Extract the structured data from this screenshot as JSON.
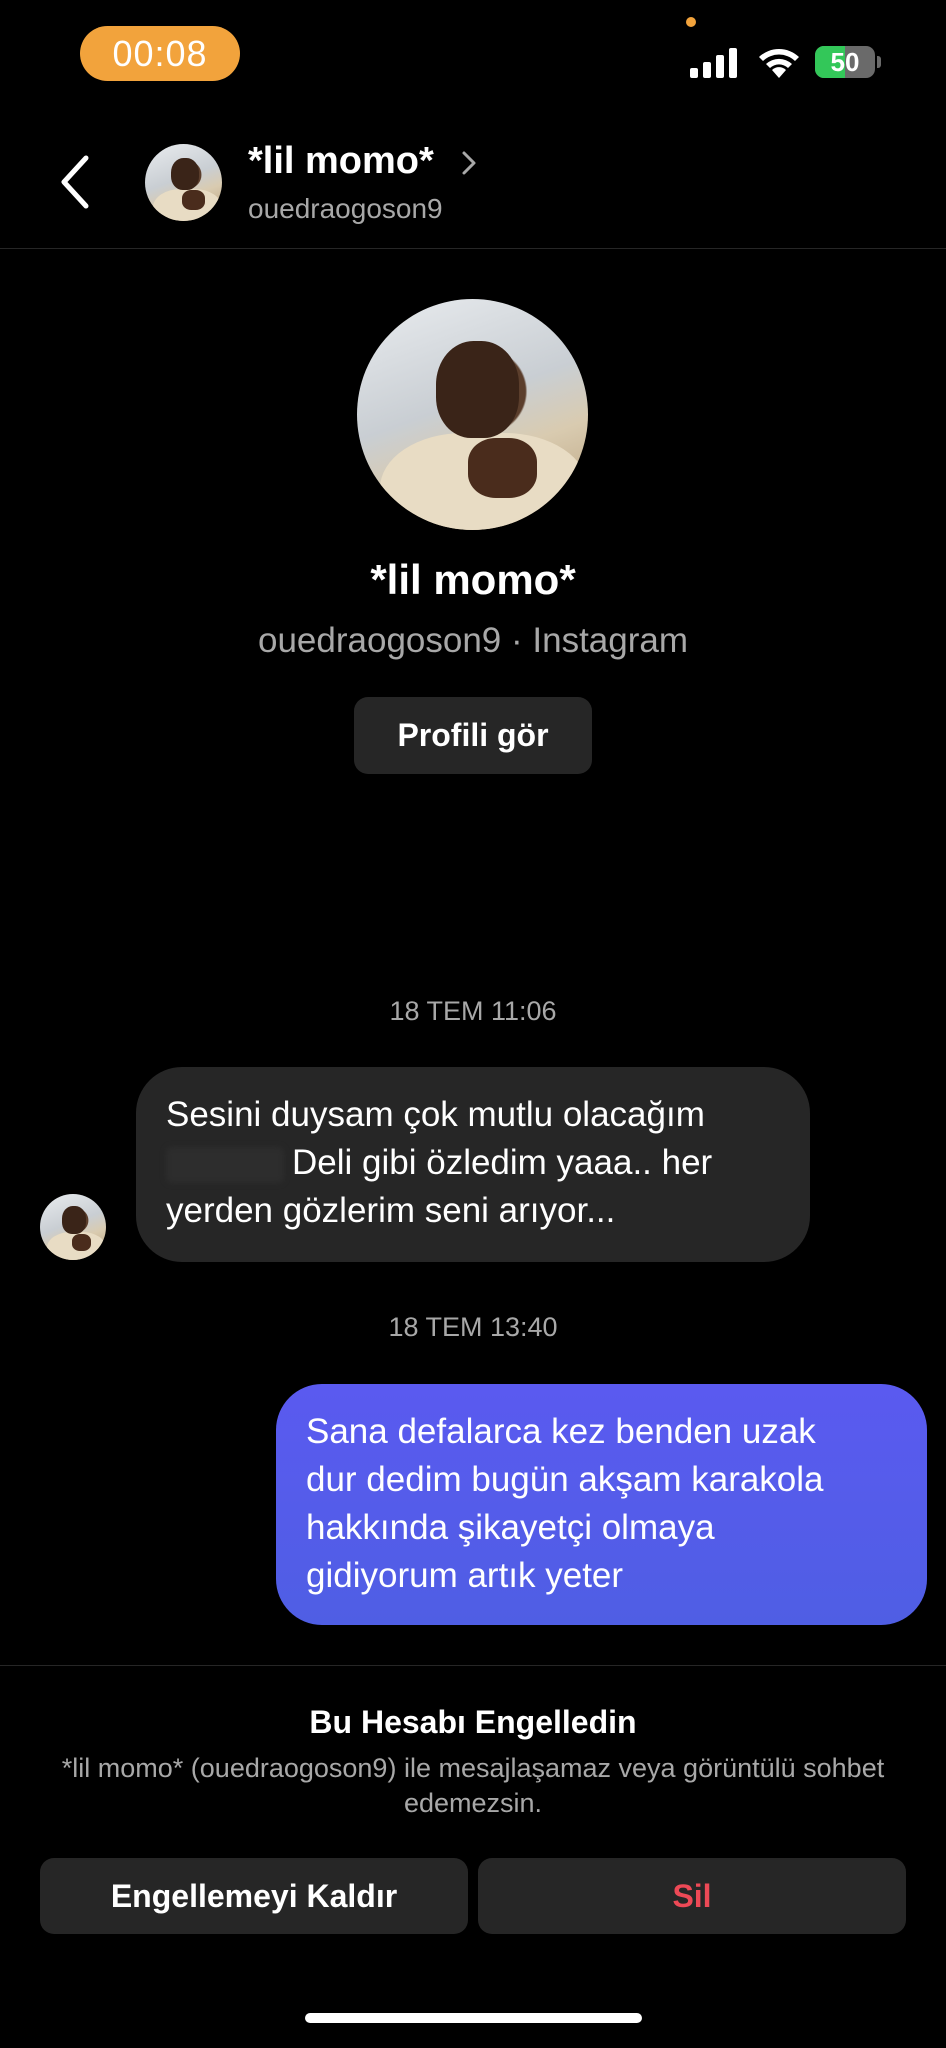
{
  "status_bar": {
    "time": "00:08",
    "battery_level": "50",
    "battery_fraction": 0.5,
    "icons": [
      "signal-icon",
      "wifi-icon",
      "battery-charging-icon"
    ]
  },
  "header": {
    "name": "*lil momo*",
    "username": "ouedraogoson9",
    "icons": [
      "back-icon",
      "chevron-right-icon"
    ]
  },
  "profile": {
    "name": "*lil momo*",
    "subtitle": "ouedraogoson9 · Instagram",
    "view_profile_label": "Profili gör"
  },
  "messages": [
    {
      "timestamp": "18 TEM 11:06",
      "direction": "incoming",
      "lines": [
        "Sesini duysam çok mutlu olacağım",
        "Deli gibi özledim yaaa.. her",
        "yerden gözlerim seni arıyor..."
      ]
    },
    {
      "timestamp": "18 TEM 13:40",
      "direction": "outgoing",
      "lines": [
        "Sana defalarca kez benden uzak",
        "dur dedim bugün akşam karakola",
        "hakkında şikayetçi olmaya",
        "gidiyorum artık yeter"
      ]
    }
  ],
  "blocked": {
    "title": "Bu Hesabı Engelledin",
    "description": "*lil momo* (ouedraogoson9) ile mesajlaşamaz veya görüntülü sohbet edemezsin.",
    "unblock_label": "Engellemeyi Kaldır",
    "delete_label": "Sil"
  },
  "colors": {
    "background": "#000000",
    "incoming_bubble": "#262626",
    "outgoing_bubble": "#5a5af0",
    "delete_red": "#ed4956",
    "time_pill": "#f2a33c",
    "battery_green": "#33c759"
  }
}
